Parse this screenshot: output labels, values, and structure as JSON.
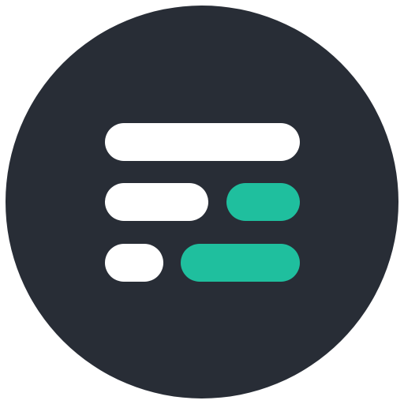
{
  "logo": {
    "icon": "menu-bars-icon",
    "colors": {
      "background": "#282d36",
      "bar_primary": "#ffffff",
      "bar_accent": "#1fbf9e"
    },
    "bars": [
      {
        "row": 1,
        "color": "white"
      },
      {
        "row": 2,
        "color": "white"
      },
      {
        "row": 2,
        "color": "green"
      },
      {
        "row": 3,
        "color": "white"
      },
      {
        "row": 3,
        "color": "green"
      }
    ]
  }
}
